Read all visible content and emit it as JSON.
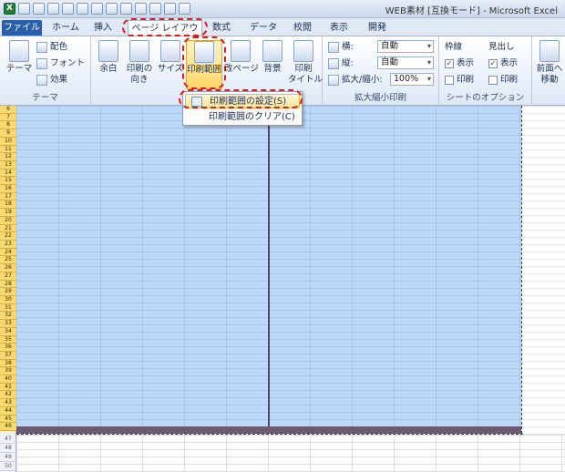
{
  "window": {
    "title": "WEB素材 [互換モード] - Microsoft Excel"
  },
  "tabs": [
    {
      "label": "ファイル"
    },
    {
      "label": "ホーム"
    },
    {
      "label": "挿入"
    },
    {
      "label": "ページ レイアウト"
    },
    {
      "label": "数式"
    },
    {
      "label": "データ"
    },
    {
      "label": "校閲"
    },
    {
      "label": "表示"
    },
    {
      "label": "開発"
    }
  ],
  "ribbon": {
    "theme": {
      "group_label": "テーマ",
      "theme_label": "テーマ",
      "colors_label": "配色",
      "fonts_label": "フォント",
      "effects_label": "効果"
    },
    "page_setup": {
      "margins_label": "余白",
      "orientation_label_1": "印刷の",
      "orientation_label_2": "向き",
      "size_label": "サイズ",
      "print_area_label": "印刷範囲",
      "breaks_label": "改ページ",
      "background_label": "背景",
      "print_titles_label_1": "印刷",
      "print_titles_label_2": "タイトル"
    },
    "scale": {
      "group_label": "拡大縮小印刷",
      "width_label": "横:",
      "width_value": "自動",
      "height_label": "縦:",
      "height_value": "自動",
      "scale_label": "拡大/縮小:",
      "scale_value": "100%"
    },
    "sheet_options": {
      "group_label": "シートのオプション",
      "gridlines_label": "枠線",
      "headings_label": "見出し",
      "view_label": "表示",
      "print_label": "印刷"
    },
    "arrange": {
      "bring_forward_1": "前面へ",
      "bring_forward_2": "移動"
    }
  },
  "menu": {
    "set_print_area": "印刷範囲の設定(S)",
    "clear_print_area": "印刷範囲のクリア(C)"
  },
  "rows": {
    "selected": [
      "6",
      "7",
      "8",
      "9",
      "10",
      "11",
      "12",
      "13",
      "14",
      "15",
      "16",
      "17",
      "18",
      "19",
      "20",
      "21",
      "22",
      "23",
      "24",
      "25",
      "26",
      "27",
      "28",
      "29",
      "30",
      "31",
      "32",
      "33",
      "34",
      "35",
      "36",
      "37",
      "38",
      "39",
      "40",
      "41",
      "42",
      "43",
      "44",
      "45",
      "46"
    ],
    "unselected": [
      "47",
      "48",
      "49",
      "50"
    ]
  },
  "colors": {
    "print_area": "#bcd8fb",
    "selected_row_header": "#f8d870",
    "annotation": "#d81e1e",
    "file_tab": "#2a5ea8"
  }
}
